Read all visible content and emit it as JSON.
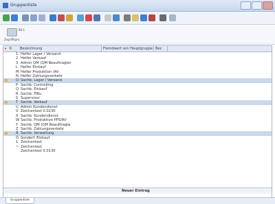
{
  "window": {
    "title": "Gruppenliste"
  },
  "ribbon": {
    "count": "80:1",
    "group_label": "Zugriffsgru.."
  },
  "table": {
    "columns": [
      "Bezeichnung",
      "Fremdwert von Hauptgruppe",
      "Bez"
    ],
    "rows": [
      {
        "code": "1",
        "label": "Helfer Lager / Versand"
      },
      {
        "code": "2",
        "label": "Helfer Verkauf"
      },
      {
        "code": "3",
        "label": "Admin QM (QM Beauftragter"
      },
      {
        "code": "L",
        "label": "Helfer Einkauf"
      },
      {
        "code": "M",
        "label": "Helfer Produktion (AV"
      },
      {
        "code": "N",
        "label": "Helfer Zahlungsverkehr"
      },
      {
        "code": "O",
        "label": "Sachb. Lager / Versand",
        "highlight": true
      },
      {
        "code": "P",
        "label": "Sachb. Controlling"
      },
      {
        "code": "Q",
        "label": "Sachb. Einkauf"
      },
      {
        "code": "R",
        "label": "Sachb. FiBu"
      },
      {
        "code": "S",
        "label": "Supervisor"
      },
      {
        "code": "T",
        "label": "Sachb. Verkauf",
        "highlight": true
      },
      {
        "code": "U",
        "label": "Admin Kundendienst"
      },
      {
        "code": "V",
        "label": "Zeichentest 0.0230"
      },
      {
        "code": "X",
        "label": "Sachb. Kundendienst"
      },
      {
        "code": "W",
        "label": "Sachb. Produktion PPS/AV"
      },
      {
        "code": "Y",
        "label": "Sachb. QM (QM Beauftragte"
      },
      {
        "code": "Z",
        "label": "Sachb. Zahlungsverkehr"
      },
      {
        "code": "Ä",
        "label": "Sachb. Verwaltung",
        "highlight": true
      },
      {
        "code": "Ö",
        "label": "Sonderf. Einkauf"
      },
      {
        "code": "1",
        "label": "Zeichentest"
      },
      {
        "code": "~",
        "label": "Zeichentest"
      },
      {
        "code": "",
        "label": "Zeichentest 0.0130"
      }
    ],
    "new_row_label": "Neuer Eintrag"
  },
  "tabs": [
    {
      "label": "Gruppenliste"
    }
  ],
  "colors": {
    "selection": "#c9d8ea",
    "header": "#e3e9f2"
  }
}
